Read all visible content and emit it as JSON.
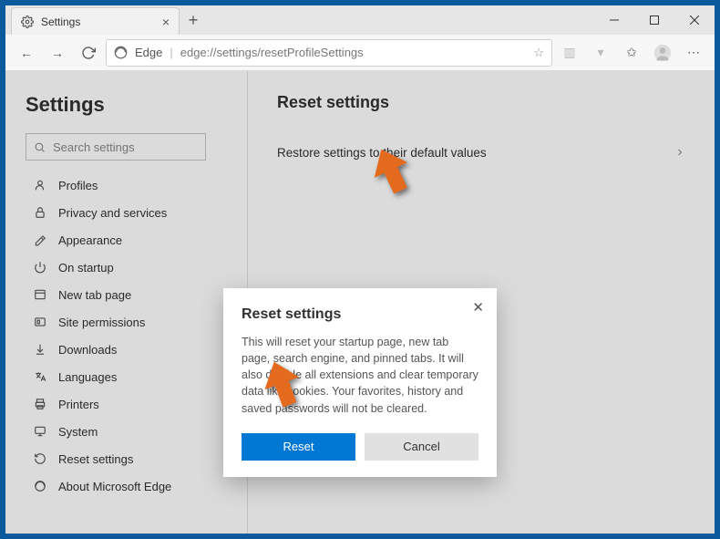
{
  "tab": {
    "title": "Settings"
  },
  "address": {
    "brand": "Edge",
    "url": "edge://settings/resetProfileSettings"
  },
  "sidebar": {
    "heading": "Settings",
    "search_placeholder": "Search settings",
    "items": [
      {
        "label": "Profiles"
      },
      {
        "label": "Privacy and services"
      },
      {
        "label": "Appearance"
      },
      {
        "label": "On startup"
      },
      {
        "label": "New tab page"
      },
      {
        "label": "Site permissions"
      },
      {
        "label": "Downloads"
      },
      {
        "label": "Languages"
      },
      {
        "label": "Printers"
      },
      {
        "label": "System"
      },
      {
        "label": "Reset settings"
      },
      {
        "label": "About Microsoft Edge"
      }
    ]
  },
  "main": {
    "heading": "Reset settings",
    "row_label": "Restore settings to their default values"
  },
  "dialog": {
    "title": "Reset settings",
    "body": "This will reset your startup page, new tab page, search engine, and pinned tabs. It will also disable all extensions and clear temporary data like cookies. Your favorites, history and saved passwords will not be cleared.",
    "reset": "Reset",
    "cancel": "Cancel"
  }
}
